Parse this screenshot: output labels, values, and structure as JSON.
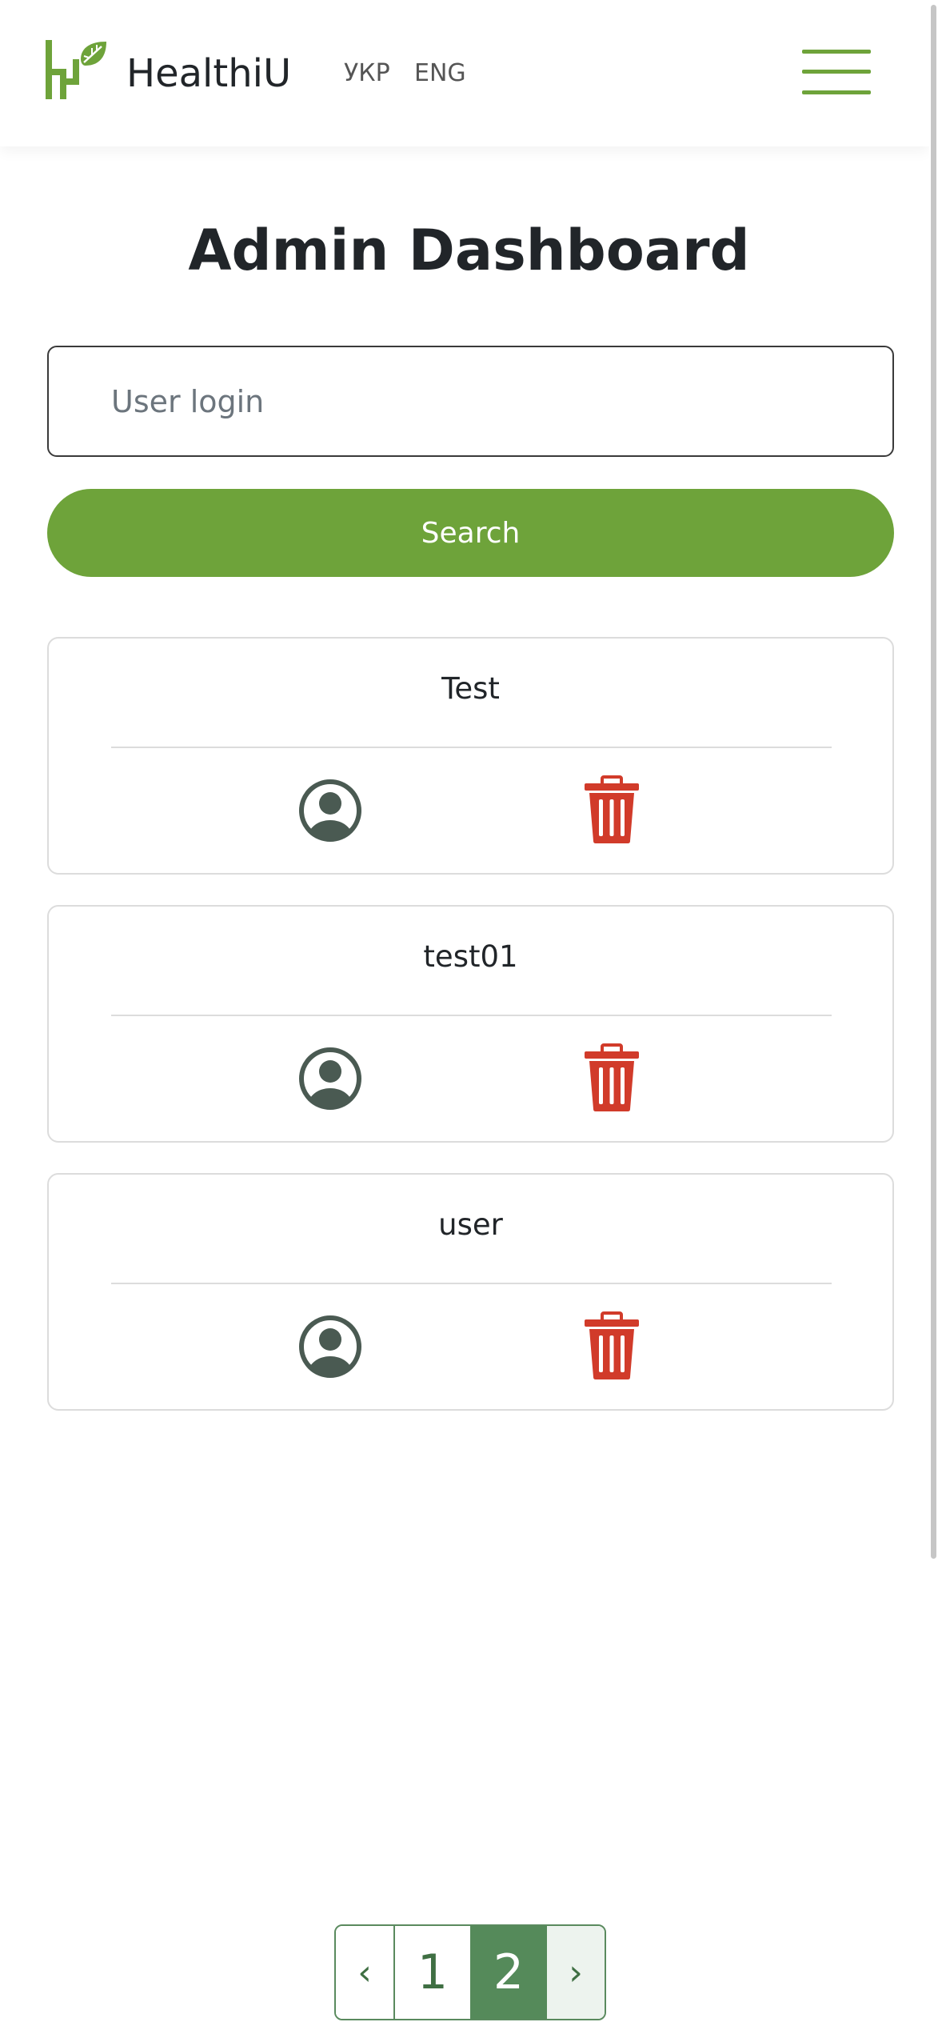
{
  "header": {
    "brand": "HealthiU",
    "languages": [
      "УКР",
      "ENG"
    ],
    "accent_color": "#6ea33a"
  },
  "main": {
    "title": "Admin Dashboard",
    "search": {
      "placeholder": "User login",
      "value": "",
      "button_label": "Search"
    },
    "users": [
      {
        "login": "Test"
      },
      {
        "login": "test01"
      },
      {
        "login": "user"
      }
    ],
    "icons": {
      "profile": "user-circle-icon",
      "delete": "trash-icon",
      "delete_color": "#d13b2a",
      "profile_color": "#4a5a52"
    }
  },
  "pagination": {
    "prev": "‹",
    "pages": [
      "1",
      "2"
    ],
    "current": "2",
    "next": "›",
    "active_color": "#558a5a"
  }
}
